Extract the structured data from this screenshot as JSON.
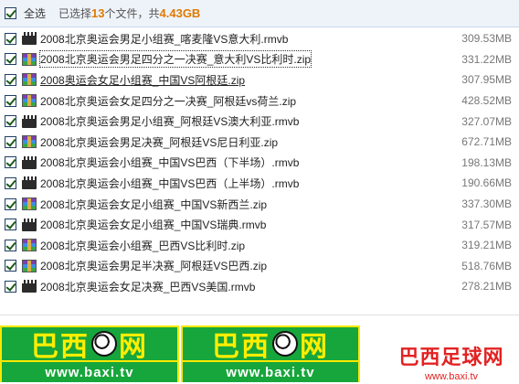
{
  "toolbar": {
    "select_all_label": "全选",
    "summary_prefix": "已选择",
    "count": "13",
    "summary_mid": "个文件，共",
    "total_size": "4.43GB"
  },
  "files": [
    {
      "icon": "video",
      "name": "2008北京奥运会男足小组赛_喀麦隆VS意大利.rmvb",
      "size": "309.53MB"
    },
    {
      "icon": "zip",
      "name": "2008北京奥运会男足四分之一决赛_意大利VS比利时.zip",
      "size": "331.22MB"
    },
    {
      "icon": "zip",
      "name": "2008奥运会女足小组赛_中国VS阿根廷.zip",
      "size": "307.95MB"
    },
    {
      "icon": "zip",
      "name": "2008北京奥运会女足四分之一决赛_阿根廷vs荷兰.zip",
      "size": "428.52MB"
    },
    {
      "icon": "video",
      "name": "2008北京奥运会男足小组赛_阿根廷VS澳大利亚.rmvb",
      "size": "327.07MB"
    },
    {
      "icon": "zip",
      "name": "2008北京奥运会男足决赛_阿根廷VS尼日利亚.zip",
      "size": "672.71MB"
    },
    {
      "icon": "video",
      "name": "2008北京奥运会小组赛_中国VS巴西（下半场）.rmvb",
      "size": "198.13MB"
    },
    {
      "icon": "video",
      "name": "2008北京奥运会小组赛_中国VS巴西（上半场）.rmvb",
      "size": "190.66MB"
    },
    {
      "icon": "zip",
      "name": "2008北京奥运会女足小组赛_中国VS新西兰.zip",
      "size": "337.30MB"
    },
    {
      "icon": "video",
      "name": "2008北京奥运会女足小组赛_中国VS瑞典.rmvb",
      "size": "317.57MB"
    },
    {
      "icon": "zip",
      "name": "2008北京奥运会小组赛_巴西VS比利时.zip",
      "size": "319.21MB"
    },
    {
      "icon": "zip",
      "name": "2008北京奥运会男足半决赛_阿根廷VS巴西.zip",
      "size": "518.76MB"
    },
    {
      "icon": "video",
      "name": "2008北京奥运会女足决赛_巴西VS美国.rmvb",
      "size": "278.21MB"
    }
  ],
  "banners": [
    {
      "title_left": "巴西",
      "title_right": "网",
      "url": "www.baxi.tv"
    },
    {
      "title_left": "巴西",
      "title_right": "网",
      "url": "www.baxi.tv"
    }
  ],
  "brand": {
    "title": "巴西足球网",
    "url": "www.baxi.tv"
  }
}
